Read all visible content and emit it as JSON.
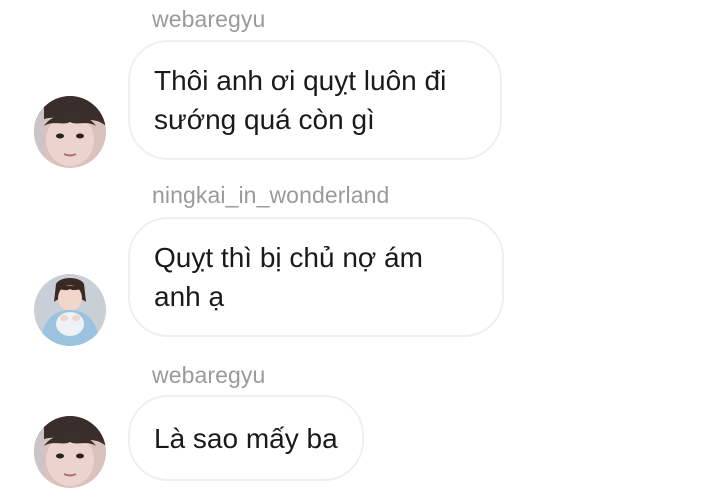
{
  "messages": [
    {
      "username": "webaregyu",
      "avatar": "avatar-webaregyu",
      "lines": [
        "Thôi anh ơi quỵt luôn đi",
        "sướng quá còn gì"
      ]
    },
    {
      "username": "ningkai_in_wonderland",
      "avatar": "avatar-ningkai",
      "lines": [
        "Quỵt thì bị chủ nợ ám",
        "anh ạ"
      ]
    },
    {
      "username": "webaregyu",
      "avatar": "avatar-webaregyu",
      "lines": [
        "Là sao mấy ba"
      ]
    }
  ],
  "colors": {
    "username": "#9a9a9a",
    "bubble_border": "#efefef",
    "text": "#1a1a1a",
    "background": "#ffffff"
  }
}
